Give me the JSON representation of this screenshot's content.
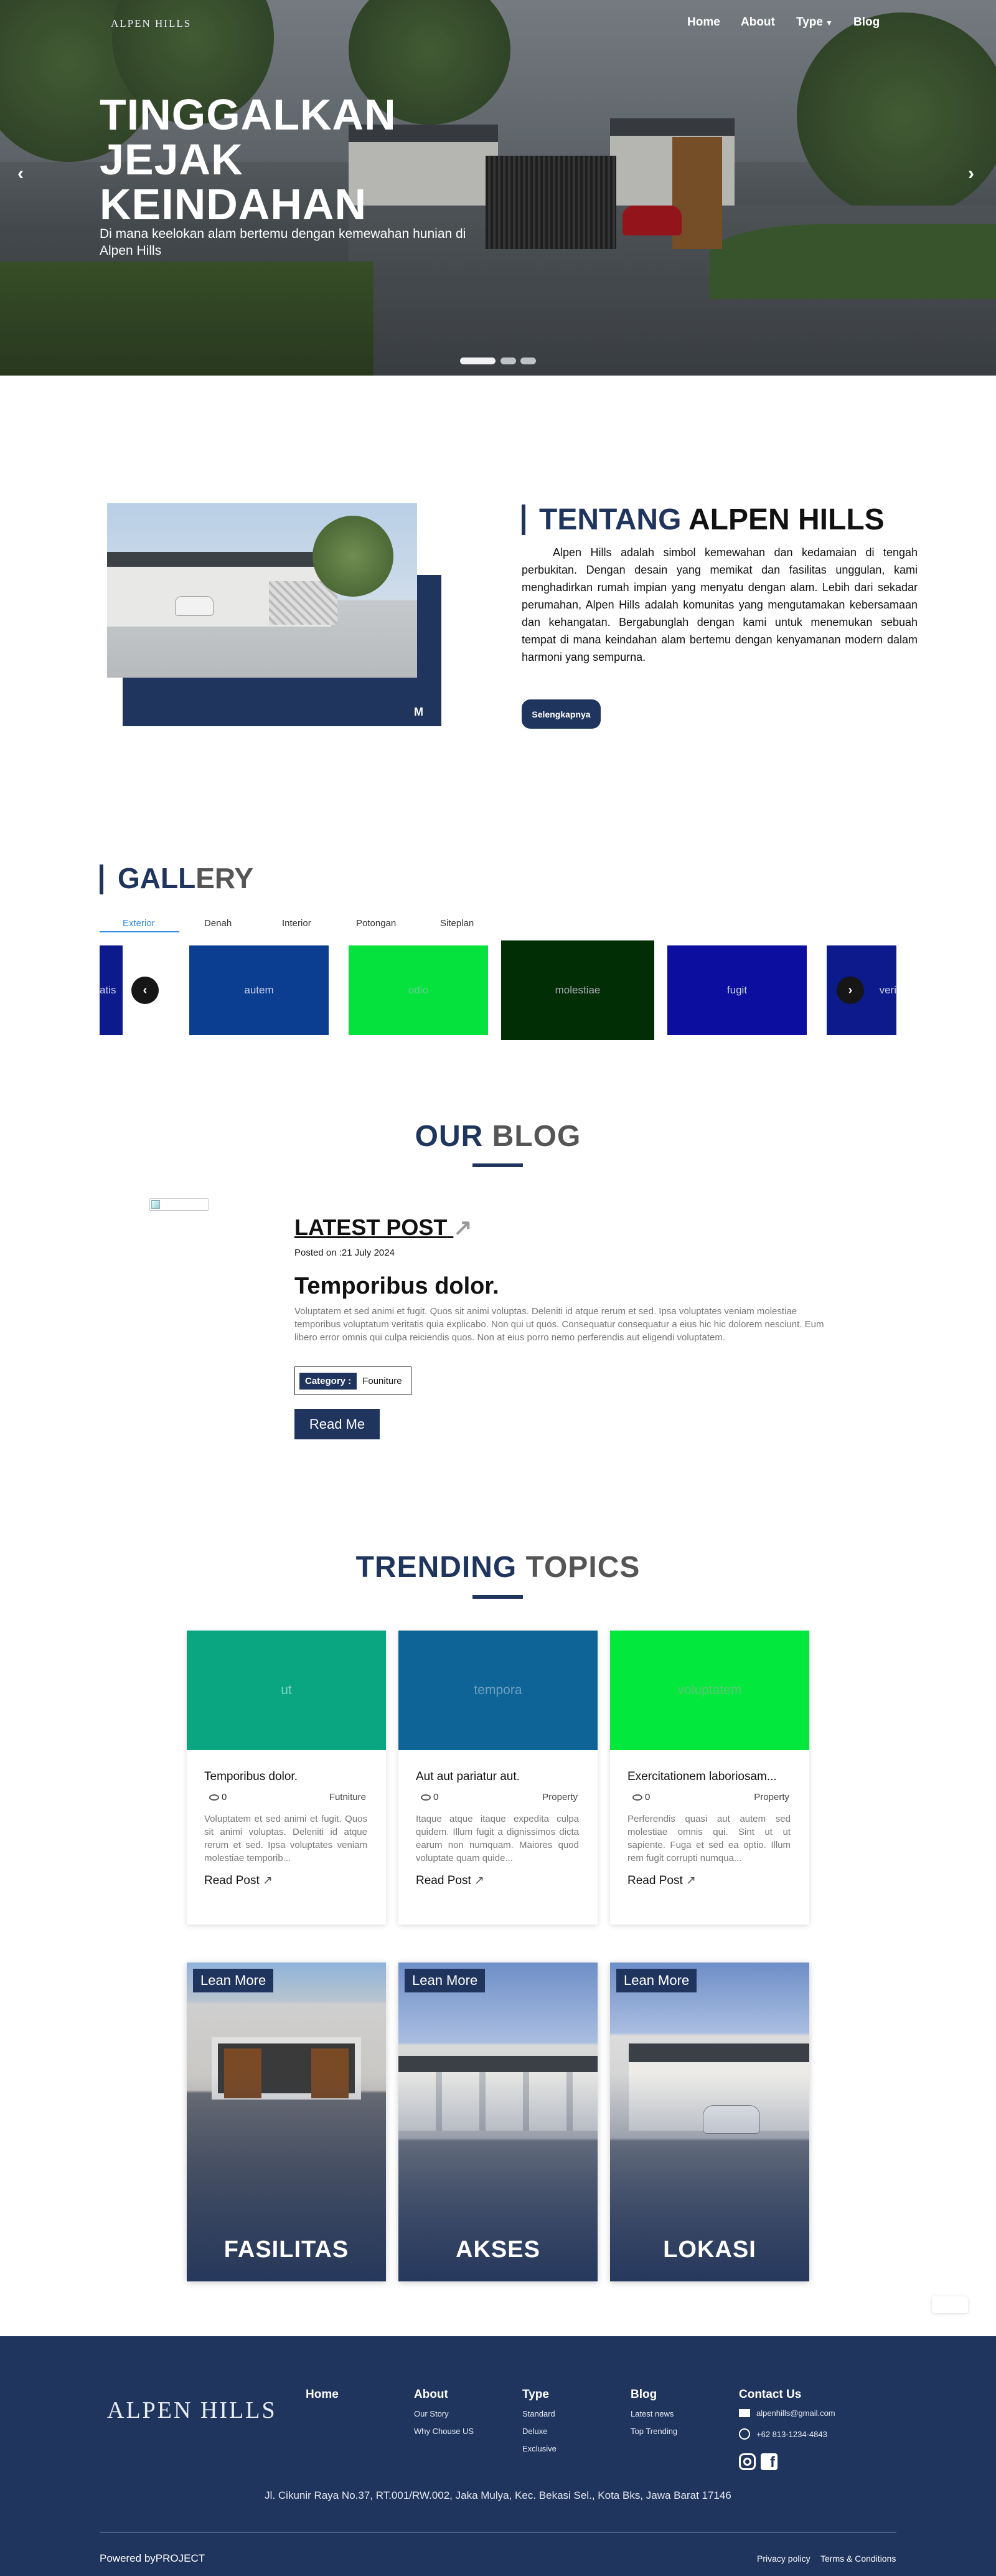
{
  "brand": {
    "name": "ALPEN HILLS",
    "navy": "#20355e"
  },
  "nav": {
    "home": "Home",
    "about": "About",
    "type": "Type",
    "blog": "Blog"
  },
  "hero": {
    "title": "TINGGALKAN JEJAK KEINDAHAN",
    "subtitle": "Di mana keelokan alam bertemu dengan kemewahan hunian di Alpen Hills",
    "slides": 3,
    "active_slide": 1
  },
  "about": {
    "title_accent": "TENTANG",
    "title_rest": "ALPEN HILLS",
    "text": "Alpen Hills adalah simbol kemewahan dan kedamaian di tengah perbukitan. Dengan desain yang memikat dan fasilitas unggulan, kami menghadirkan rumah impian yang menyatu dengan alam. Lebih dari sekadar perumahan, Alpen Hills adalah komunitas yang mengutamakan kebersamaan dan kehangatan. Bergabunglah dengan kami untuk menemukan sebuah tempat di mana keindahan alam bertemu dengan kenyamanan modern dalam harmoni yang sempurna.",
    "button": "Selengkapnya"
  },
  "gallery": {
    "title_accent": "GALL",
    "title_rest": "ERY",
    "tabs": [
      "Exterior",
      "Denah",
      "Interior",
      "Potongan",
      "Siteplan"
    ],
    "active_tab": "Exterior",
    "tiles": [
      {
        "label": "atis",
        "color": "#0c1a8c"
      },
      {
        "label": "autem",
        "color": "#0b3d91"
      },
      {
        "label": "odio",
        "color": "#05e23d"
      },
      {
        "label": "molestiae",
        "color": "#022e05"
      },
      {
        "label": "fugit",
        "color": "#0b0e9e"
      },
      {
        "label": "veri",
        "color": "#0c1a8c"
      }
    ]
  },
  "blog": {
    "title_accent": "OUR",
    "title_rest": "BLOG",
    "latest_label": "LATEST POST",
    "posted": "Posted on :21 July 2024",
    "post_title": "Temporibus dolor.",
    "post_body": "Voluptatem et sed animi et fugit. Quos sit animi voluptas. Deleniti id atque rerum et sed. Ipsa voluptates veniam molestiae temporibus voluptatum veritatis quia explicabo. Non qui ut quos. Consequatur consequatur a eius hic hic dolorem nesciunt. Eum libero error omnis qui culpa reiciendis quos. Non at eius porro nemo perferendis aut eligendi voluptatem.",
    "category_label": "Category :",
    "category_value": "Founiture",
    "read_button": "Read Me"
  },
  "trending": {
    "title_accent": "TRENDING",
    "title_rest": "TOPICS",
    "cards": [
      {
        "image_label": "ut",
        "image_color": "#0aa682",
        "title": "Temporibus dolor.",
        "views": "0",
        "category": "Futniture",
        "desc": "Voluptatem et sed animi et fugit. Quos sit animi voluptas. Deleniti id atque rerum et sed. Ipsa voluptates veniam molestiae temporib...",
        "read": "Read Post"
      },
      {
        "image_label": "tempora",
        "image_color": "#0e6496",
        "title": "Aut aut pariatur aut.",
        "views": "0",
        "category": "Property",
        "desc": "Itaque atque itaque expedita culpa quidem. Illum fugit a dignissimos dicta earum non numquam. Maiores quod voluptate quam quide...",
        "read": "Read Post"
      },
      {
        "image_label": "voluptatem",
        "image_color": "#03e83c",
        "title": "Exercitationem laboriosam...",
        "views": "0",
        "category": "Property",
        "desc": "Perferendis quasi aut autem sed molestiae omnis qui. Sint ut ut sapiente. Fuga et sed ea optio. Illum rem fugit corrupti numqua...",
        "read": "Read Post"
      }
    ],
    "features": [
      {
        "button": "Lean More",
        "name": "FASILITAS"
      },
      {
        "button": "Lean More",
        "name": "AKSES"
      },
      {
        "button": "Lean More",
        "name": "LOKASI"
      }
    ]
  },
  "footer": {
    "home": "Home",
    "about": "About",
    "about_links": [
      "Our Story",
      "Why Chouse US"
    ],
    "type": "Type",
    "type_links": [
      "Standard",
      "Deluxe",
      "Exclusive"
    ],
    "blog": "Blog",
    "blog_links": [
      "Latest news",
      "Top Trending"
    ],
    "contact": "Contact Us",
    "email": "alpenhills@gmail.com",
    "phone": "+62 813-1234-4843",
    "address": "Jl. Cikunir Raya No.37, RT.001/RW.002, Jaka Mulya, Kec. Bekasi Sel., Kota Bks, Jawa Barat 17146",
    "powered": "Powered byPROJECT",
    "privacy": "Privacy policy",
    "terms": "Terms & Conditions"
  }
}
